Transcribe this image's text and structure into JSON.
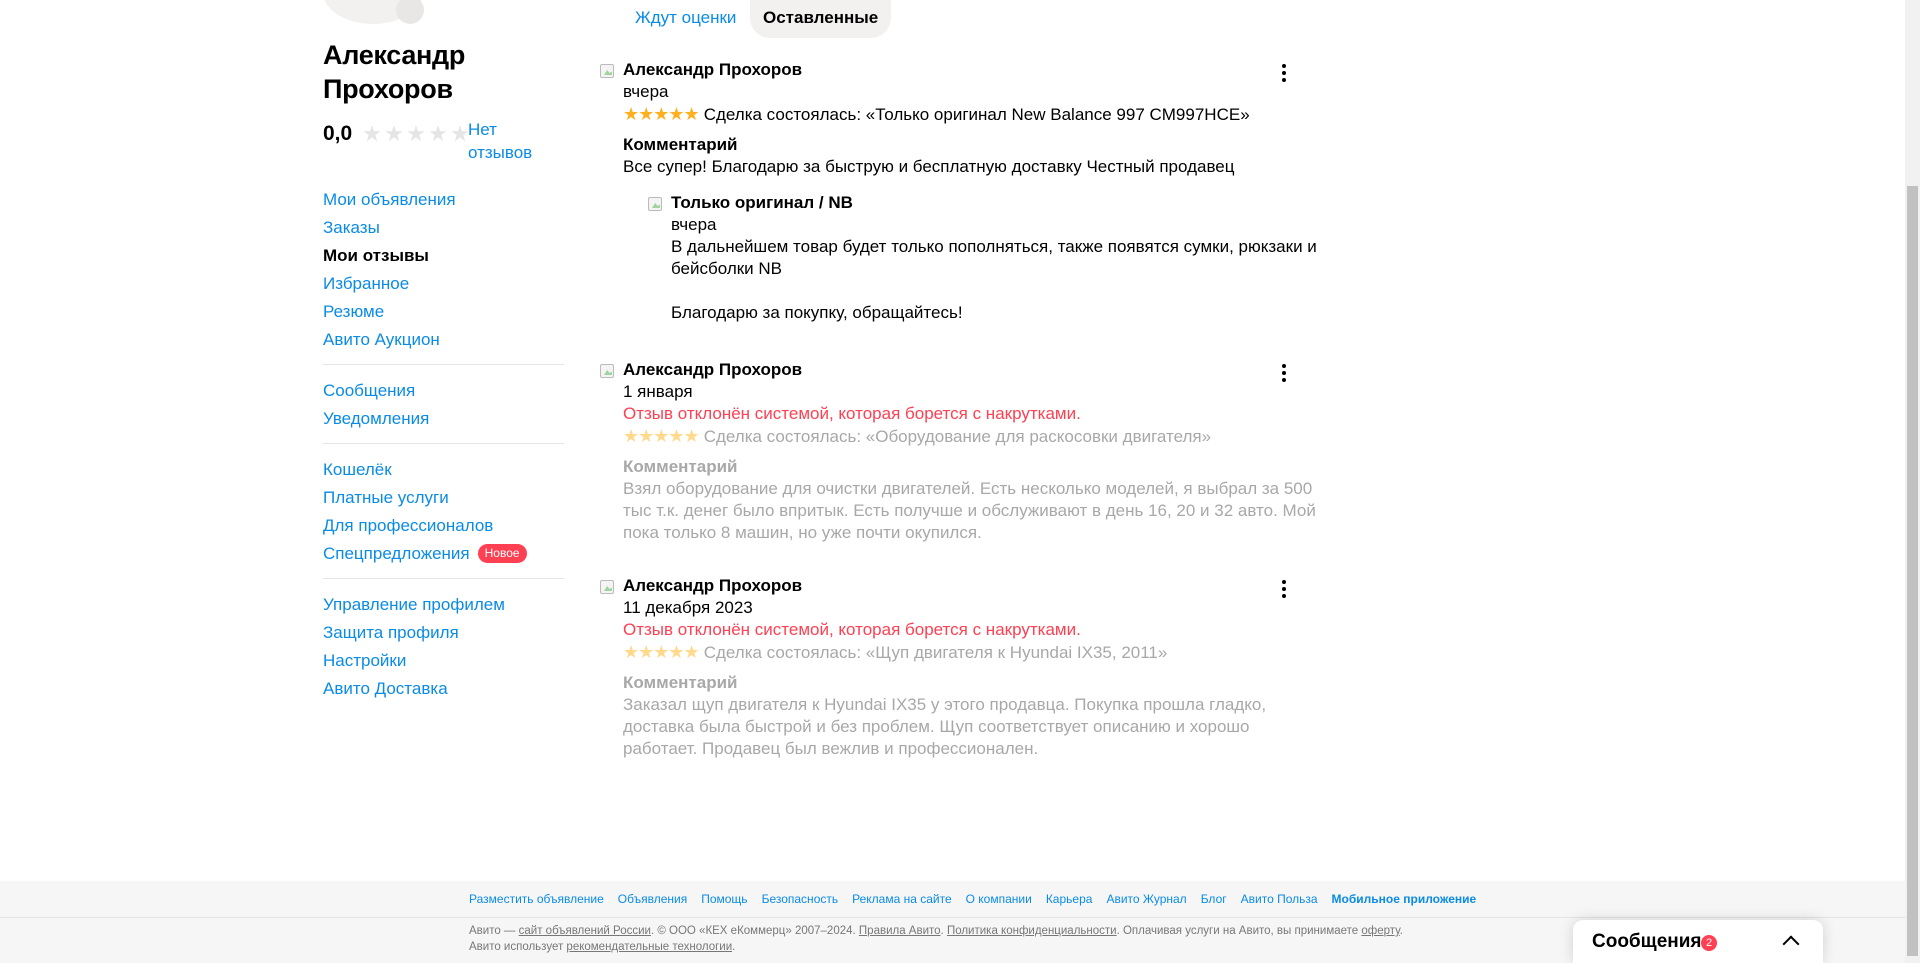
{
  "profile": {
    "name": "Александр Прохоров",
    "rating": "0,0",
    "rating_stars": 0,
    "no_reviews_label": "Нет отзывов"
  },
  "sidebar": {
    "groups": [
      [
        {
          "label": "Мои объявления",
          "active": false
        },
        {
          "label": "Заказы",
          "active": false
        },
        {
          "label": "Мои отзывы",
          "active": true
        },
        {
          "label": "Избранное",
          "active": false
        },
        {
          "label": "Резюме",
          "active": false
        },
        {
          "label": "Авито Аукцион",
          "active": false
        }
      ],
      [
        {
          "label": "Сообщения",
          "active": false
        },
        {
          "label": "Уведомления",
          "active": false
        }
      ],
      [
        {
          "label": "Кошелёк",
          "active": false
        },
        {
          "label": "Платные услуги",
          "active": false
        },
        {
          "label": "Для профессионалов",
          "active": false
        },
        {
          "label": "Спецпредложения",
          "active": false,
          "badge": "Новое"
        }
      ],
      [
        {
          "label": "Управление профилем",
          "active": false
        },
        {
          "label": "Защита профиля",
          "active": false
        },
        {
          "label": "Настройки",
          "active": false
        },
        {
          "label": "Авито Доставка",
          "active": false
        }
      ]
    ]
  },
  "tabs": {
    "awaiting": "Ждут оценки",
    "left": "Оставленные"
  },
  "reviews": [
    {
      "author": "Александр Прохоров",
      "date": "вчера",
      "rejected_text": "",
      "stars": 5,
      "deal": "Сделка состоялась: «Только оригинал New Balance 997 CM997HCE»",
      "comment_title": "Комментарий",
      "comment": "Все супер! Благодарю за быструю и бесплатную доставку Честный продавец",
      "dimmed": false,
      "reply": {
        "author": "Только оригинал / NB",
        "date": "вчера",
        "text": "В дальнейшем товар будет только пополняться, также появятся сумки, рюкзаки и бейсболки NB\n\nБлагодарю за покупку, обращайтесь!"
      }
    },
    {
      "author": "Александр Прохоров",
      "date": "1 января",
      "rejected_text": "Отзыв отклонён системой, которая борется с накрутками.",
      "stars": 5,
      "deal": "Сделка состоялась: «Оборудование для раскосовки двигателя»",
      "comment_title": "Комментарий",
      "comment": "Взял оборудование для очистки двигателей. Есть несколько моделей, я выбрал за 500 тыс т.к. денег было впритык. Есть получше и обслуживают в день 16, 20 и 32 авто. Мой пока только 8 машин, но уже почти окупился.",
      "dimmed": true
    },
    {
      "author": "Александр Прохоров",
      "date": "11 декабря 2023",
      "rejected_text": "Отзыв отклонён системой, которая борется с накрутками.",
      "stars": 5,
      "deal": "Сделка состоялась: «Щуп двигателя к Hyundai IX35, 2011»",
      "comment_title": "Комментарий",
      "comment": "Заказал щуп двигателя к Hyundai IX35 у этого продавца. Покупка прошла гладко, доставка была быстрой и без проблем. Щуп соответствует описанию и хорошо работает. Продавец был вежлив и профессионален.",
      "dimmed": true
    }
  ],
  "footer": {
    "links": [
      {
        "label": "Разместить объявление",
        "strong": false
      },
      {
        "label": "Объявления",
        "strong": false
      },
      {
        "label": "Помощь",
        "strong": false
      },
      {
        "label": "Безопасность",
        "strong": false
      },
      {
        "label": "Реклама на сайте",
        "strong": false
      },
      {
        "label": "О компании",
        "strong": false
      },
      {
        "label": "Карьера",
        "strong": false
      },
      {
        "label": "Авито Журнал",
        "strong": false
      },
      {
        "label": "Блог",
        "strong": false
      },
      {
        "label": "Авито Польза",
        "strong": false
      },
      {
        "label": "Мобильное приложение",
        "strong": true
      }
    ],
    "legal_1": "Авито — ",
    "legal_link_1": "сайт объявлений России",
    "legal_2": ". © ООО «КЕХ еКоммерц» 2007–2024. ",
    "legal_link_2": "Правила Авито",
    "legal_3": ". ",
    "legal_link_3": "Политика конфиденциальности",
    "legal_4": ". Оплачивая услуги на Авито, вы принимаете ",
    "legal_link_4": "оферту",
    "legal_5": ". Авито использует ",
    "legal_link_5": "рекомендательные технологии",
    "legal_6": "."
  },
  "messenger": {
    "title": "Сообщения",
    "count": "2"
  },
  "colors": {
    "link": "#0a8be5",
    "star": "#ffb021",
    "error": "#ff4053",
    "muted": "#a8a8a8"
  }
}
